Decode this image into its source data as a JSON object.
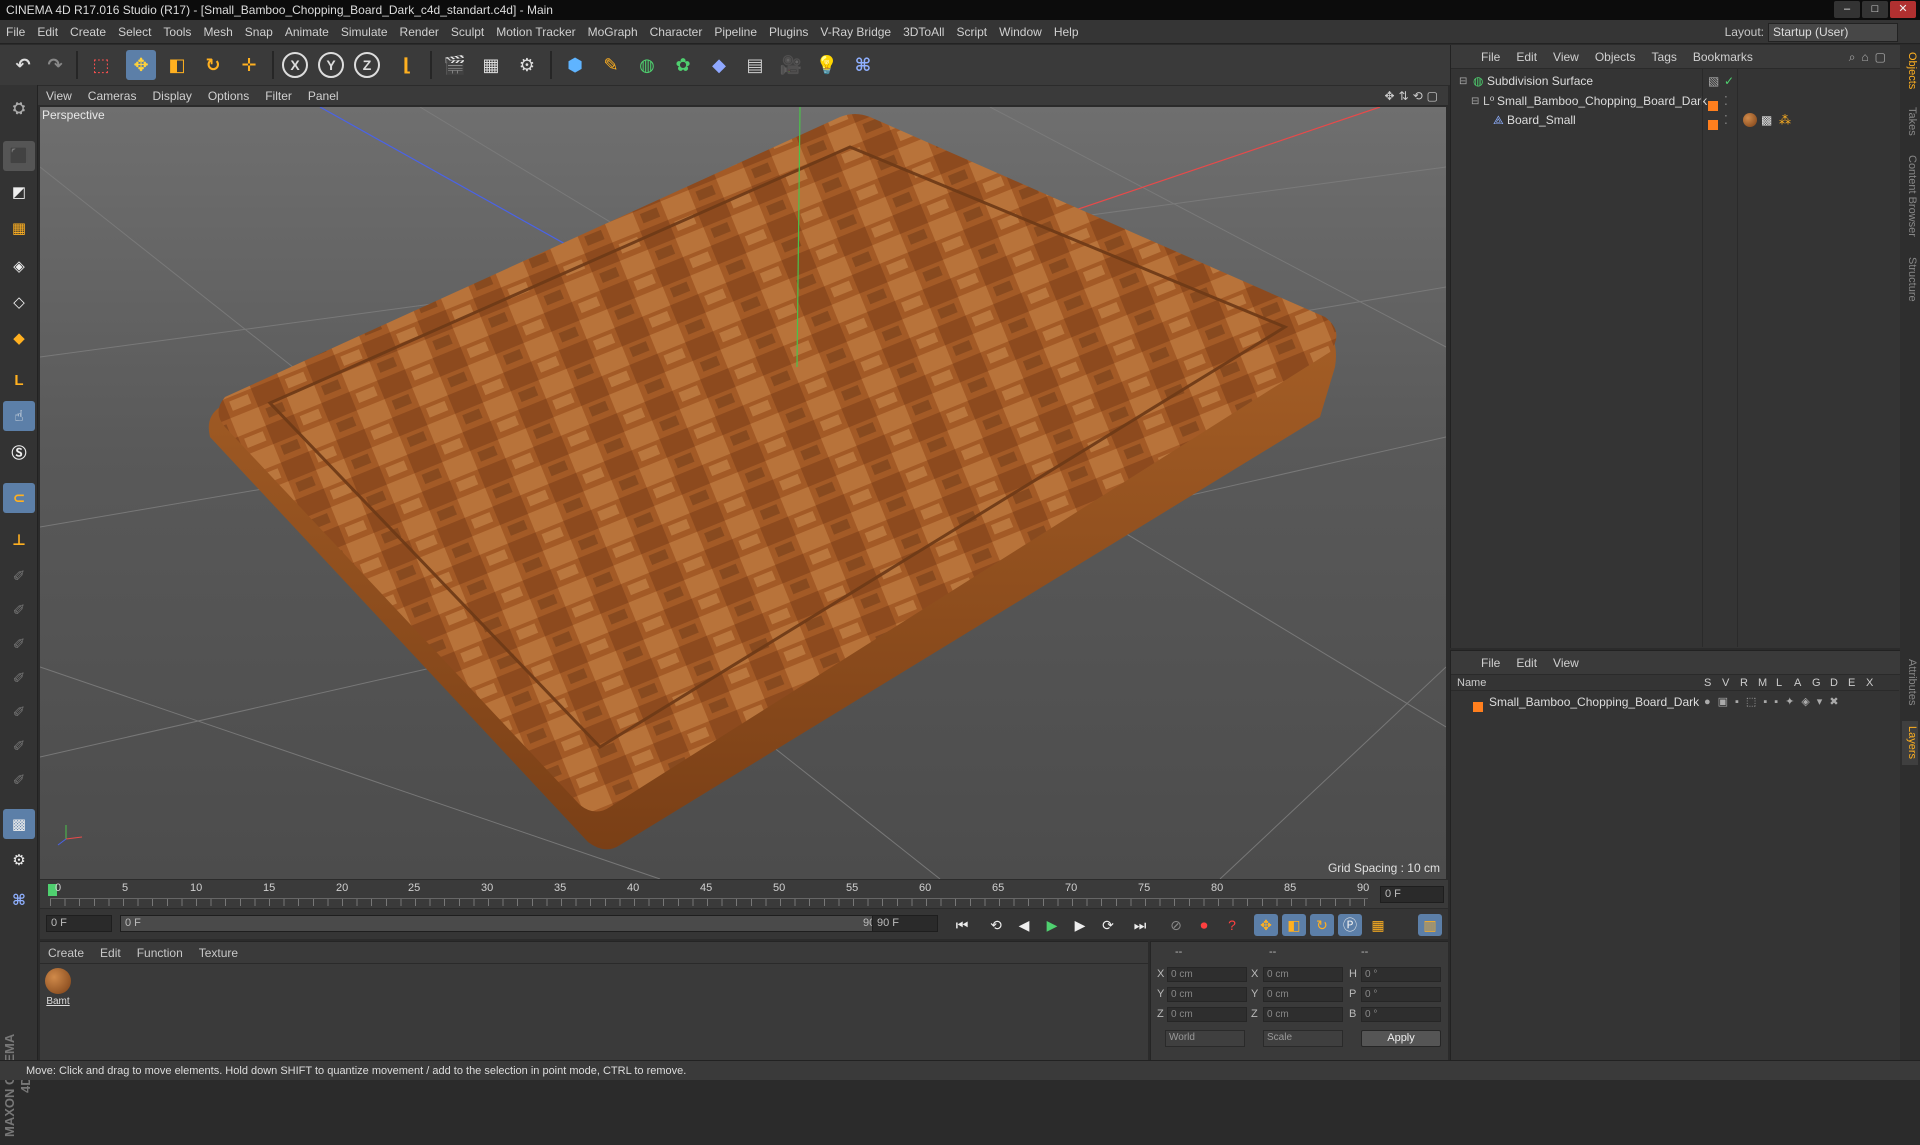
{
  "window": {
    "title": "CINEMA 4D R17.016 Studio (R17) - [Small_Bamboo_Chopping_Board_Dark_c4d_standart.c4d] - Main"
  },
  "menu": [
    "File",
    "Edit",
    "Create",
    "Select",
    "Tools",
    "Mesh",
    "Snap",
    "Animate",
    "Simulate",
    "Render",
    "Sculpt",
    "Motion Tracker",
    "MoGraph",
    "Character",
    "Pipeline",
    "Plugins",
    "V-Ray Bridge",
    "3DToAll",
    "Script",
    "Window",
    "Help"
  ],
  "layout": {
    "label": "Layout:",
    "value": "Startup (User)"
  },
  "toolbar": {
    "x": "X",
    "y": "Y",
    "z": "Z"
  },
  "viewport": {
    "menu": [
      "View",
      "Cameras",
      "Display",
      "Options",
      "Filter",
      "Panel"
    ],
    "label": "Perspective",
    "grid_spacing": "Grid Spacing : 10 cm"
  },
  "timeline": {
    "ticks": [
      "0",
      "5",
      "10",
      "15",
      "20",
      "25",
      "30",
      "35",
      "40",
      "45",
      "50",
      "55",
      "60",
      "65",
      "70",
      "75",
      "80",
      "85",
      "90"
    ],
    "current_frame": "0 F",
    "start": "0 F",
    "range_start": "0 F",
    "range_end": "90 F",
    "end": "90 F"
  },
  "materials": {
    "menu": [
      "Create",
      "Edit",
      "Function",
      "Texture"
    ],
    "item": "Bamt"
  },
  "coords": {
    "headers": [
      "--",
      "--",
      "--"
    ],
    "rows": [
      {
        "a": "X",
        "v1": "0 cm",
        "b": "X",
        "v2": "0 cm",
        "c": "H",
        "v3": "0 °"
      },
      {
        "a": "Y",
        "v1": "0 cm",
        "b": "Y",
        "v2": "0 cm",
        "c": "P",
        "v3": "0 °"
      },
      {
        "a": "Z",
        "v1": "0 cm",
        "b": "Z",
        "v2": "0 cm",
        "c": "B",
        "v3": "0 °"
      }
    ],
    "world": "World",
    "scale": "Scale",
    "apply": "Apply"
  },
  "objects": {
    "menu": [
      "File",
      "Edit",
      "View",
      "Objects",
      "Tags",
      "Bookmarks"
    ],
    "items": [
      "Subdivision Surface",
      "Small_Bamboo_Chopping_Board_Dark",
      "Board_Small"
    ]
  },
  "layers": {
    "menu": [
      "File",
      "Edit",
      "View"
    ],
    "name_header": "Name",
    "cols": [
      "S",
      "V",
      "R",
      "M",
      "L",
      "A",
      "G",
      "D",
      "E",
      "X"
    ],
    "item": "Small_Bamboo_Chopping_Board_Dark"
  },
  "right_tabs": [
    "Objects",
    "Takes",
    "Content Browser",
    "Structure",
    "Attributes",
    "Layers"
  ],
  "status": "Move: Click and drag to move elements. Hold down SHIFT to quantize movement / add to the selection in point mode, CTRL to remove.",
  "brand": "MAXON CINEMA 4D",
  "colors": {
    "accent": "#ff7f1e",
    "wood": "#a35a26",
    "x_axis": "#e84a4a",
    "y_axis": "#4ac24a",
    "z_axis": "#4a63e8"
  }
}
